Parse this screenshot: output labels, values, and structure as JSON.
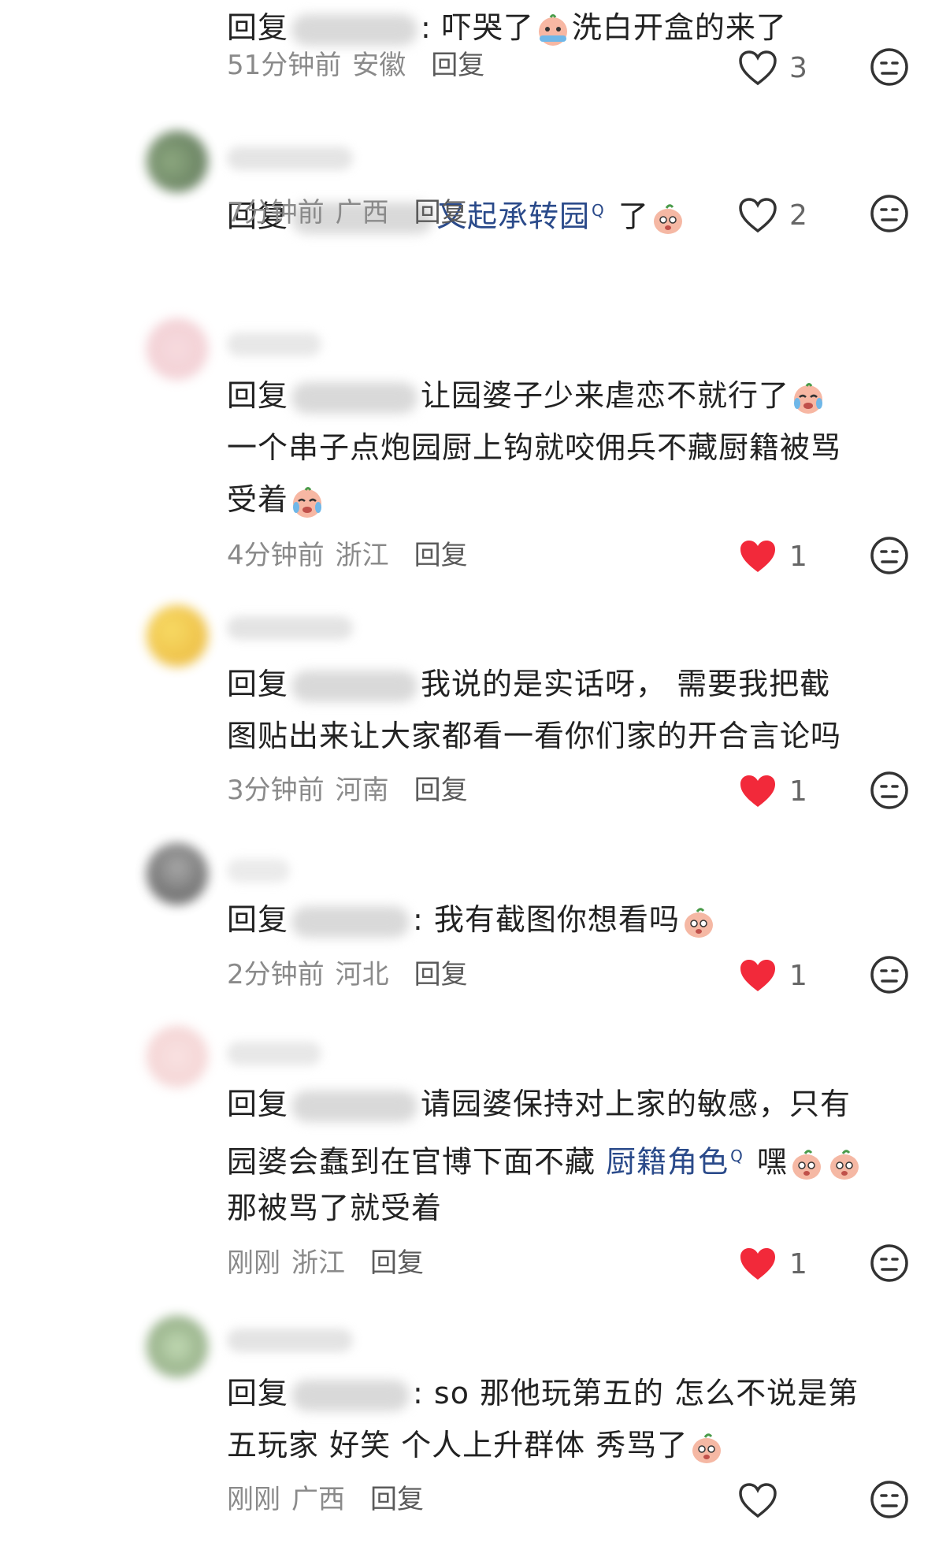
{
  "comments": [
    {
      "lines": [
        {
          "prefix": "回复",
          "blur": 160,
          "after_blur": ": 吓哭了",
          "emoji": "wrap-icon-crying",
          "text2": "洗白开盒的来了"
        }
      ],
      "time": "51分钟前",
      "location": "安徽",
      "reply": "回复",
      "likes": "3",
      "liked": false
    },
    {
      "lines": [
        {
          "prefix": "回复",
          "blur": 180,
          "link": "又起承转园",
          "search_mark": "Q",
          "after_link": " 了",
          "emoji": "peach-icon"
        }
      ],
      "time": "7分钟前",
      "location": "广西",
      "reply": "回复",
      "likes": "2",
      "liked": false
    },
    {
      "lines": [
        {
          "prefix": "回复",
          "blur": 160,
          "text": "让园婆子少来虐恋不就行了",
          "emoji": "crying-icon"
        },
        {
          "text": "一个串子点炮园厨上钩就咬佣兵不藏厨籍被骂"
        },
        {
          "text": "受着",
          "emoji": "crying-icon"
        }
      ],
      "time": "4分钟前",
      "location": "浙江",
      "reply": "回复",
      "likes": "1",
      "liked": true
    },
    {
      "lines": [
        {
          "prefix": "回复",
          "blur": 160,
          "text": "我说的是实话呀， 需要我把截"
        },
        {
          "text": "图贴出来让大家都看一看你们家的开合言论吗"
        }
      ],
      "time": "3分钟前",
      "location": "河南",
      "reply": "回复",
      "likes": "1",
      "liked": true
    },
    {
      "lines": [
        {
          "prefix": "回复",
          "blur": 150,
          "text": ": 我有截图你想看吗",
          "emoji": "peach-icon"
        }
      ],
      "time": "2分钟前",
      "location": "河北",
      "reply": "回复",
      "likes": "1",
      "liked": true
    },
    {
      "lines": [
        {
          "prefix": "回复",
          "blur": 160,
          "text": "请园婆保持对上家的敏感，只有"
        },
        {
          "text": "园婆会蠢到在官博下面不藏 ",
          "link": "厨籍角色",
          "search_mark": "Q",
          "after_link": " 嘿",
          "emoji": "peach-icon",
          "emoji2": "peach-icon"
        },
        {
          "text": "那被骂了就受着"
        }
      ],
      "time": "刚刚",
      "location": "浙江",
      "reply": "回复",
      "likes": "1",
      "liked": true
    },
    {
      "lines": [
        {
          "prefix": "回复",
          "blur": 150,
          "text": ": so 那他玩第五的 怎么不说是第"
        },
        {
          "text": "五玩家 好笑 个人上升群体 秀骂了",
          "emoji": "peach-icon"
        }
      ],
      "time": "刚刚",
      "location": "广西",
      "reply": "回复",
      "likes": "",
      "liked": false
    }
  ],
  "colors": {
    "like_red": "#f2293a",
    "text": "#222222",
    "meta_gray": "#8a8a8a",
    "link_blue": "#2a4a8a"
  }
}
